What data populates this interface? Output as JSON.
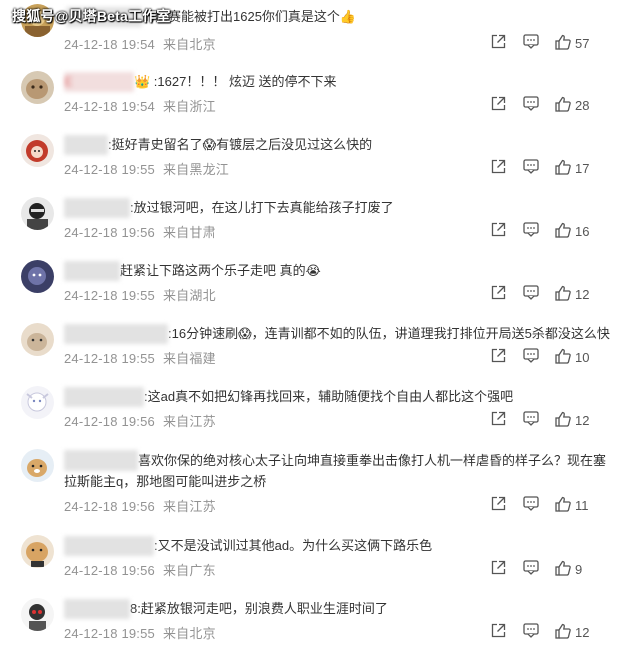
{
  "watermark": "搜狐号@贝塔Beta工作室",
  "comments": [
    {
      "username": "",
      "text": "的比赛能被打出1625你们真是这个👍",
      "date": "24-12-18 19:54",
      "location": "来自北京",
      "likes": "57"
    },
    {
      "username": "E",
      "text": "👑 :1627！！！ 炫迈 送的停不下来",
      "date": "24-12-18 19:54",
      "location": "来自浙江",
      "likes": "28"
    },
    {
      "username": "",
      "text": ":挺好青史留名了😱有镀层之后没见过这么快的",
      "date": "24-12-18 19:55",
      "location": "来自黑龙江",
      "likes": "17"
    },
    {
      "username": "",
      "text": ":放过银河吧，在这儿打下去真能给孩子打废了",
      "date": "24-12-18 19:56",
      "location": "来自甘肃",
      "likes": "16"
    },
    {
      "username": "",
      "text": "赶紧让下路这两个乐子走吧 真的😭",
      "date": "24-12-18 19:55",
      "location": "来自湖北",
      "likes": "12"
    },
    {
      "username": "",
      "text": ":16分钟速刷😱，连青训都不如的队伍，讲道理我打排位开局送5杀都没这么快",
      "date": "24-12-18 19:55",
      "location": "来自福建",
      "likes": "10"
    },
    {
      "username": "",
      "text": ":这ad真不如把幻锋再找回来，辅助随便找个自由人都比这个强吧",
      "date": "24-12-18 19:56",
      "location": "来自江苏",
      "likes": "12"
    },
    {
      "username": "",
      "text": "喜欢你保的绝对核心太子让向坤直接重拳出击像打人机一样虐昏的样子么？现在塞拉斯能主q，那地图可能叫进步之桥",
      "date": "24-12-18 19:56",
      "location": "来自江苏",
      "likes": "11"
    },
    {
      "username": "",
      "text": ":又不是没试训过其他ad。为什么买这俩下路乐色",
      "date": "24-12-18 19:56",
      "location": "来自广东",
      "likes": "9"
    },
    {
      "username": "",
      "text": "8:赶紧放银河走吧，别浪费人职业生涯时间了",
      "date": "24-12-18 19:55",
      "location": "来自北京",
      "likes": "12"
    }
  ],
  "icons": {
    "share": "share-icon",
    "reply": "comment-icon",
    "like": "thumbs-up-icon"
  }
}
